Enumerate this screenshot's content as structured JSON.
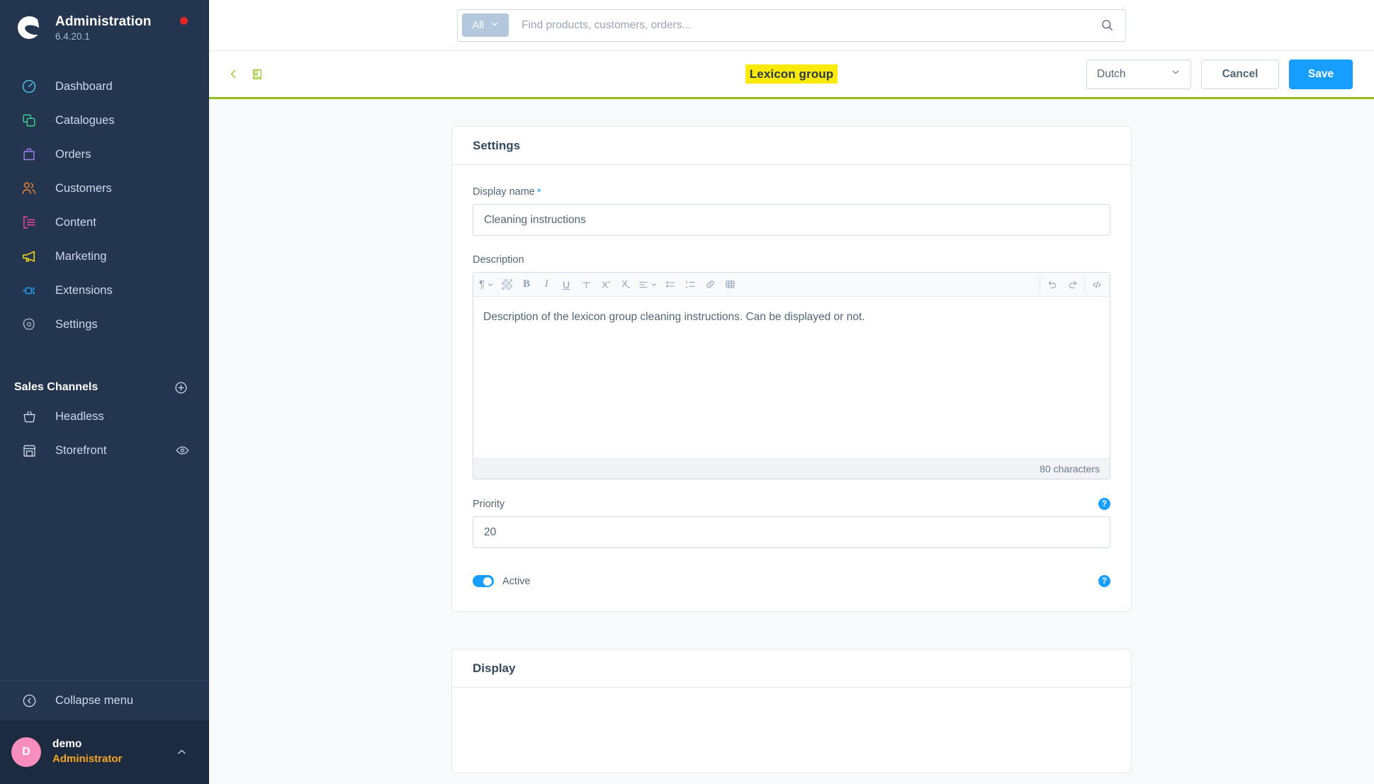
{
  "sidebar": {
    "brand": {
      "title": "Administration",
      "version": "6.4.20.1",
      "logo_icon": "shopware-logo-icon",
      "status_dot": "notification-dot"
    },
    "items": [
      {
        "label": "Dashboard",
        "icon": "dashboard-gauge-icon",
        "color": "#4dc6ea"
      },
      {
        "label": "Catalogues",
        "icon": "catalogues-layers-icon",
        "color": "#3ecf8e"
      },
      {
        "label": "Orders",
        "icon": "orders-bag-icon",
        "color": "#9b7dea"
      },
      {
        "label": "Customers",
        "icon": "customers-people-icon",
        "color": "#f0822e"
      },
      {
        "label": "Content",
        "icon": "content-list-icon",
        "color": "#f0439c"
      },
      {
        "label": "Marketing",
        "icon": "marketing-megaphone-icon",
        "color": "#f5d916"
      },
      {
        "label": "Extensions",
        "icon": "extensions-plug-icon",
        "color": "#1b9ef0"
      },
      {
        "label": "Settings",
        "icon": "settings-gear-icon",
        "color": "#9aa7b8"
      }
    ],
    "sales_channels": {
      "title": "Sales Channels",
      "add_icon": "plus-circle-icon",
      "items": [
        {
          "label": "Headless",
          "icon": "basket-icon",
          "trailing_icon": null
        },
        {
          "label": "Storefront",
          "icon": "storefront-icon",
          "trailing_icon": "eye-icon"
        }
      ]
    },
    "collapse": {
      "label": "Collapse menu",
      "icon": "collapse-chevron-left-icon"
    },
    "user": {
      "initial": "D",
      "name": "demo",
      "role": "Administrator",
      "caret_icon": "chevron-up-icon"
    }
  },
  "search": {
    "scope_label": "All",
    "scope_caret_icon": "chevron-down-icon",
    "placeholder": "Find products, customers, orders...",
    "value": "",
    "search_icon": "search-magnifier-icon"
  },
  "smartbar": {
    "back_icon": "chevron-left-icon",
    "context_icon": "book-icon",
    "title": "Lexicon group",
    "title_highlight_color": "#fbe907",
    "accent_line_color": "#94c11f",
    "language": {
      "value": "Dutch",
      "caret_icon": "chevron-down-icon"
    },
    "cancel_label": "Cancel",
    "save_label": "Save",
    "save_color": "#189eff"
  },
  "settings_card": {
    "title": "Settings",
    "display_name": {
      "label": "Display name",
      "required_marker": "*",
      "value": "Cleaning instructions",
      "placeholder": ""
    },
    "description": {
      "label": "Description",
      "body_text": "Description of the lexicon group cleaning instructions. Can be displayed or not.",
      "char_count": "80 characters",
      "toolbar_left": [
        {
          "name": "paragraph-format-icon",
          "glyph": "¶",
          "has_caret": true
        },
        {
          "name": "text-color-picker-icon",
          "glyph": "",
          "has_caret": false
        },
        {
          "name": "bold-icon",
          "glyph": "B",
          "has_caret": false
        },
        {
          "name": "italic-icon",
          "glyph": "I",
          "has_caret": false
        },
        {
          "name": "underline-icon",
          "glyph": "U",
          "has_caret": false
        },
        {
          "name": "strikethrough-icon",
          "glyph": "S",
          "has_caret": false
        },
        {
          "name": "superscript-icon",
          "glyph": "X",
          "has_caret": false
        },
        {
          "name": "subscript-icon",
          "glyph": "X",
          "has_caret": false
        },
        {
          "name": "text-align-icon",
          "glyph": "≡",
          "has_caret": true
        },
        {
          "name": "bullet-list-icon",
          "glyph": "",
          "has_caret": false
        },
        {
          "name": "ordered-list-icon",
          "glyph": "",
          "has_caret": false
        },
        {
          "name": "insert-link-icon",
          "glyph": "",
          "has_caret": false
        },
        {
          "name": "insert-table-icon",
          "glyph": "",
          "has_caret": false
        }
      ],
      "toolbar_right": [
        {
          "name": "undo-icon"
        },
        {
          "name": "redo-icon"
        },
        {
          "name": "source-code-icon"
        }
      ]
    },
    "priority": {
      "label": "Priority",
      "value": "20",
      "help_icon": "help-question-icon",
      "help_glyph": "?"
    },
    "active": {
      "label": "Active",
      "enabled": true,
      "help_icon": "help-question-icon",
      "help_glyph": "?",
      "accent_color": "#189eff"
    }
  },
  "display_card": {
    "title": "Display"
  }
}
